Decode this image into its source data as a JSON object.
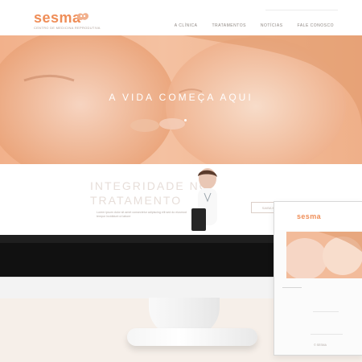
{
  "header": {
    "logo_text": "sesma",
    "logo_tagline": "CENTRO DE MEDICINA REPRODUTIVA",
    "nav": [
      {
        "label": "A CLÍNICA"
      },
      {
        "label": "TRATAMENTOS"
      },
      {
        "label": "NOTÍCIAS"
      },
      {
        "label": "FALE CONOSCO"
      }
    ]
  },
  "hero": {
    "title": "A VIDA COMEÇA AQUI"
  },
  "section": {
    "title": "INTEGRIDADE NO TRATAMENTO",
    "text": "Lorem ipsum dolor sit amet consectetur adipiscing elit sed do eiusmod tempor incididunt ut labore",
    "button_label": "SAIBA MAIS"
  },
  "phone": {
    "logo_text": "sesma",
    "footer_text": "© SESMA"
  },
  "colors": {
    "accent": "#ef8e58",
    "hero_tint": "#f4c1a2"
  }
}
